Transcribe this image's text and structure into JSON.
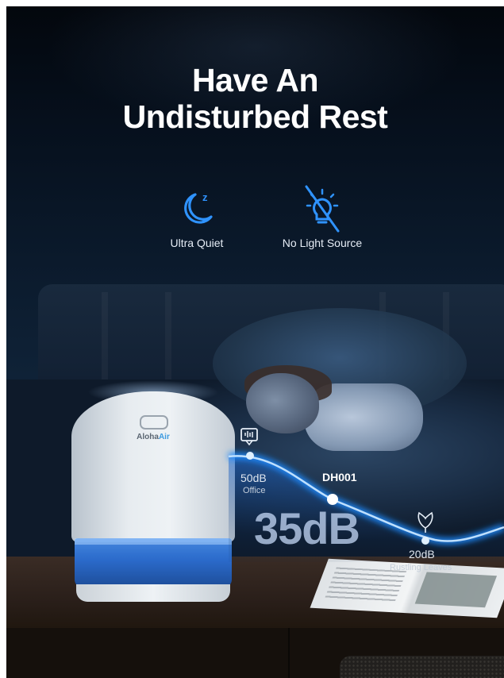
{
  "headline": {
    "line1": "Have An",
    "line2": "Undisturbed Rest"
  },
  "features": [
    {
      "label": "Ultra Quiet",
      "icon": "moon-zzz-icon"
    },
    {
      "label": "No Light Source",
      "icon": "crossed-out-lightbulb-icon"
    }
  ],
  "noise_scale": {
    "markers": [
      {
        "db": "50dB",
        "label": "Office",
        "icon": "office-icon"
      },
      {
        "db": "20dB",
        "label": "Rustling Leaves",
        "icon": "leaf-icon"
      }
    ],
    "product": {
      "label": "DH001",
      "db": "35dB"
    }
  },
  "device": {
    "brand_prefix": "Aloha",
    "brand_suffix": "Air"
  },
  "colors": {
    "accent_blue": "#1f8bff",
    "curve_glow": "#9fd0ff",
    "text_white": "#ffffff"
  }
}
